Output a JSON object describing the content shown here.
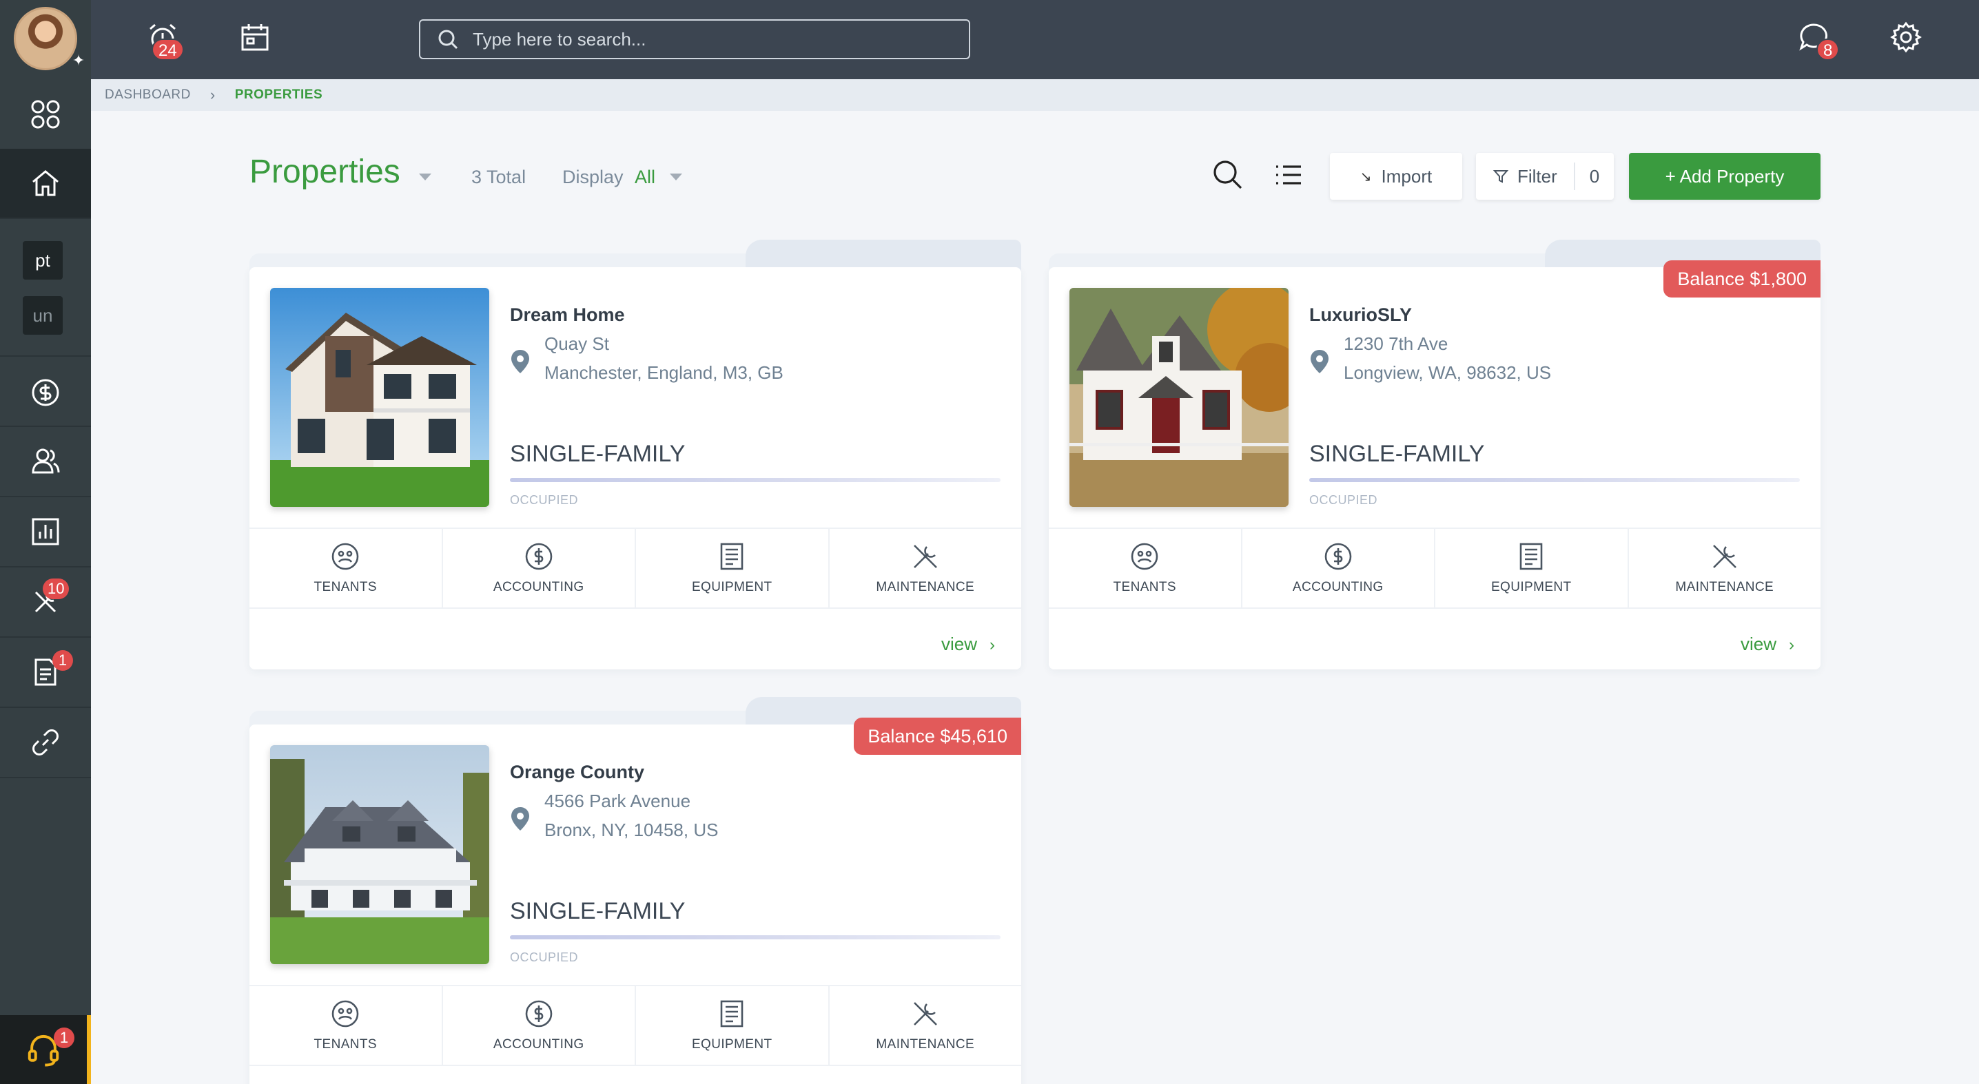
{
  "topbar": {
    "alarm_badge": "24",
    "messages_badge": "8",
    "search_placeholder": "Type here to search..."
  },
  "sidebar": {
    "tag1": "pt",
    "tag2": "un",
    "maintenance_badge": "10",
    "documents_badge": "1",
    "support_badge": "1"
  },
  "breadcrumb": {
    "root": "DASHBOARD",
    "separator": "›",
    "current": "PROPERTIES"
  },
  "header": {
    "title": "Properties",
    "total": "3 Total",
    "display_label": "Display",
    "display_value": "All",
    "import_label": "Import",
    "filter_label": "Filter",
    "filter_count": "0",
    "add_label": "+  Add Property"
  },
  "actions": {
    "tenants": "TENANTS",
    "accounting": "ACCOUNTING",
    "equipment": "EQUIPMENT",
    "maintenance": "MAINTENANCE",
    "view": "view"
  },
  "properties": [
    {
      "name": "Dream Home",
      "street": "Quay St",
      "city": "Manchester, England, M3, GB",
      "type": "SINGLE-FAMILY",
      "status": "OCCUPIED",
      "balance": ""
    },
    {
      "name": "LuxurioSLY",
      "street": "1230 7th Ave",
      "city": "Longview, WA, 98632, US",
      "type": "SINGLE-FAMILY",
      "status": "OCCUPIED",
      "balance": "Balance $1,800"
    },
    {
      "name": "Orange County",
      "street": "4566 Park Avenue",
      "city": "Bronx, NY, 10458, US",
      "type": "SINGLE-FAMILY",
      "status": "OCCUPIED",
      "balance": "Balance $45,610"
    }
  ],
  "colors": {
    "brand_green": "#3a9b3f",
    "sidebar": "#353f43",
    "topbar": "#3c4551",
    "balance_red": "#e25a5a",
    "support_accent": "#f2b31c"
  }
}
